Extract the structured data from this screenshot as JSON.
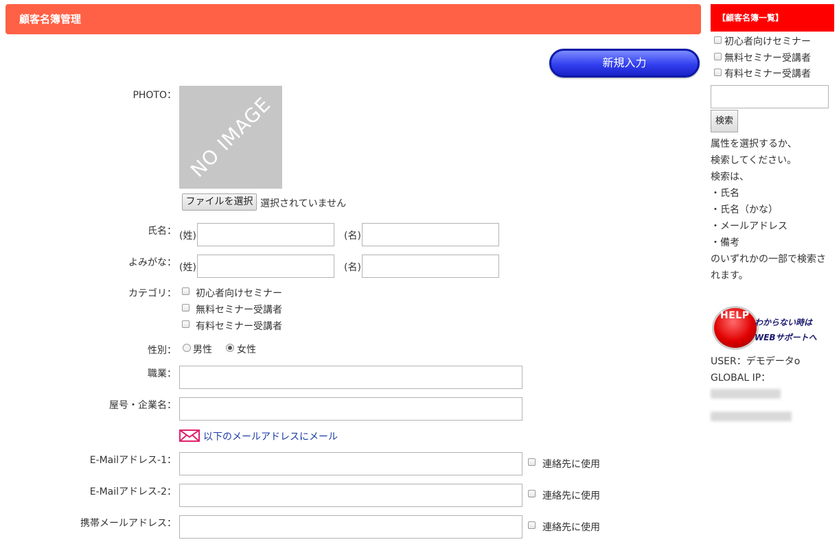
{
  "header": {
    "title": "顧客名簿管理"
  },
  "toolbar": {
    "new_label": "新規入力"
  },
  "form": {
    "photo_label": "PHOTO：",
    "photo_placeholder": "NO IMAGE",
    "file_button": "ファイルを選択",
    "file_status": "選択されていません",
    "name_label": "氏名：",
    "kana_label": "よみがな：",
    "last_prefix": "(姓)",
    "first_prefix": "(名)",
    "category_label": "カテゴリ：",
    "categories": [
      "初心者向けセミナー",
      "無料セミナー受講者",
      "有料セミナー受講者"
    ],
    "gender_label": "性別：",
    "gender_options": [
      "男性",
      "女性"
    ],
    "gender_selected": "女性",
    "job_label": "職業：",
    "company_label": "屋号・企業名：",
    "mail_link": "以下のメールアドレスにメール",
    "email1_label": "E-Mailアドレス-1：",
    "email2_label": "E-Mailアドレス-2：",
    "mobile_label": "携帯メールアドレス：",
    "contact_use": "連絡先に使用"
  },
  "sidebar": {
    "title": "【顧客名簿一覧】",
    "filters": [
      "初心者向けセミナー",
      "無料セミナー受講者",
      "有料セミナー受講者"
    ],
    "search_button": "検索",
    "help_lines": [
      "属性を選択するか、",
      "検索してください。",
      "検索は、",
      "・氏名",
      "・氏名（かな）",
      "・メールアドレス",
      "・備考",
      "のいずれかの一部で検索さ",
      "れます。"
    ],
    "help_banner_word": "HELP",
    "help_banner_line1": "わからない時は",
    "help_banner_line2": "WEBサポートへ",
    "user_label": "USER：デモデータo",
    "global_ip_label": "GLOBAL IP："
  },
  "colors": {
    "header": "#ff6146",
    "sidebar_head": "#ff0000",
    "button_blue": "#3340f0"
  }
}
